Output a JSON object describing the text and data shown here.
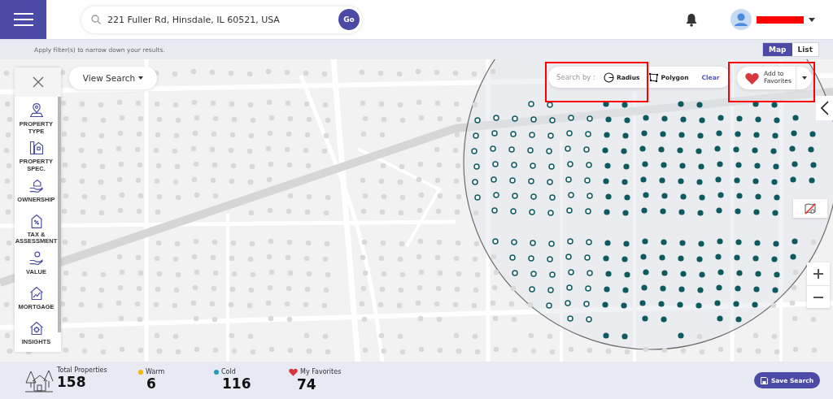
{
  "header": {
    "search": {
      "value": "221 Fuller Rd, Hinsdale, IL 60521, USA"
    },
    "go_button": "Go"
  },
  "filter_hint": "Apply filter(s) to narrow down your results.",
  "view_toggle": [
    {
      "label": "Map",
      "selected": true
    },
    {
      "label": "List",
      "selected": false
    }
  ],
  "view_search": "View Search",
  "filters": [
    {
      "label": "PROPERTY TYPE"
    },
    {
      "label": "PROPERTY SPEC."
    },
    {
      "label": "OWNERSHIP"
    },
    {
      "label": "TAX & ASSESSMENT"
    },
    {
      "label": "VALUE"
    },
    {
      "label": "MORTGAGE"
    },
    {
      "label": "INSIGHTS"
    }
  ],
  "search_by": {
    "label": "Search by :",
    "options": [
      {
        "label": "Radius",
        "kind": "radius"
      },
      {
        "label": "Polygon",
        "kind": "polygon"
      }
    ],
    "clear": "Clear"
  },
  "favorites_button": "Add to Favorites",
  "stats": [
    {
      "label": "Total Properties",
      "value": "158",
      "kind": "total"
    },
    {
      "label": "Warm",
      "value": "6",
      "kind": "dot",
      "color": "#f5b700"
    },
    {
      "label": "Cold",
      "value": "116",
      "kind": "dot",
      "color": "#1f9cb8"
    },
    {
      "label": "My Favorites",
      "value": "74",
      "kind": "heart"
    }
  ],
  "save_search": "Save Search"
}
